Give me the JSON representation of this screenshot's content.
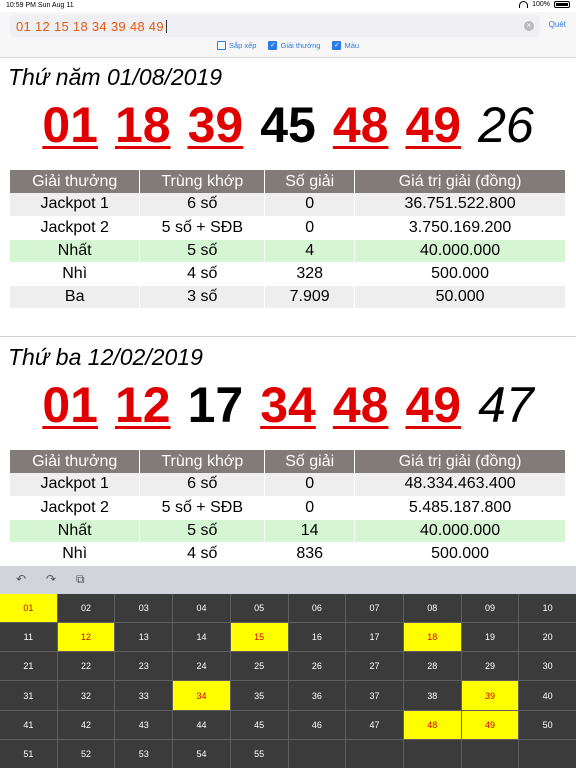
{
  "status": {
    "time_date": "10:59 PM   Sun Aug 11",
    "battery": "100%"
  },
  "search": {
    "value": "01 12 15 18 34 39 48 49",
    "scan_label": "Quét",
    "clear": "×"
  },
  "options": [
    {
      "label": "Sắp xếp",
      "checked": false
    },
    {
      "label": "Giải thưởng",
      "checked": true
    },
    {
      "label": "Màu",
      "checked": true
    }
  ],
  "headers": [
    "Giải thưởng",
    "Trùng khớp",
    "Số giải",
    "Giá trị giải (đồng)"
  ],
  "draws": [
    {
      "date": "Thứ năm 01/08/2019",
      "balls": [
        {
          "n": "01",
          "hit": true
        },
        {
          "n": "18",
          "hit": true
        },
        {
          "n": "39",
          "hit": true
        },
        {
          "n": "45",
          "hit": false
        },
        {
          "n": "48",
          "hit": true
        },
        {
          "n": "49",
          "hit": true
        }
      ],
      "bonus": "26",
      "rows": [
        {
          "prize": "Jackpot 1",
          "match": "6 số",
          "count": "0",
          "value": "36.751.522.800",
          "highlight": false
        },
        {
          "prize": "Jackpot 2",
          "match": "5 số + SĐB",
          "count": "0",
          "value": "3.750.169.200",
          "highlight": false
        },
        {
          "prize": "Nhất",
          "match": "5 số",
          "count": "4",
          "value": "40.000.000",
          "highlight": true
        },
        {
          "prize": "Nhì",
          "match": "4 số",
          "count": "328",
          "value": "500.000",
          "highlight": false
        },
        {
          "prize": "Ba",
          "match": "3 số",
          "count": "7.909",
          "value": "50.000",
          "highlight": false
        }
      ]
    },
    {
      "date": "Thứ ba 12/02/2019",
      "balls": [
        {
          "n": "01",
          "hit": true
        },
        {
          "n": "12",
          "hit": true
        },
        {
          "n": "17",
          "hit": false
        },
        {
          "n": "34",
          "hit": true
        },
        {
          "n": "48",
          "hit": true
        },
        {
          "n": "49",
          "hit": true
        }
      ],
      "bonus": "47",
      "rows": [
        {
          "prize": "Jackpot 1",
          "match": "6 số",
          "count": "0",
          "value": "48.334.463.400",
          "highlight": false
        },
        {
          "prize": "Jackpot 2",
          "match": "5 số + SĐB",
          "count": "0",
          "value": "5.485.187.800",
          "highlight": false
        },
        {
          "prize": "Nhất",
          "match": "5 số",
          "count": "14",
          "value": "40.000.000",
          "highlight": true
        },
        {
          "prize": "Nhì",
          "match": "4 số",
          "count": "836",
          "value": "500.000",
          "highlight": false
        }
      ]
    }
  ],
  "toolbar": {
    "undo": "↶",
    "redo": "↷",
    "copy": "⧉"
  },
  "picker": {
    "max": 55,
    "selected": [
      "01",
      "12",
      "15",
      "18",
      "34",
      "39",
      "48",
      "49"
    ]
  },
  "colors": {
    "hit": "#e00000",
    "selected_cell": "#ffff00",
    "search_text": "#e25a12",
    "accent": "#2c7be5"
  }
}
